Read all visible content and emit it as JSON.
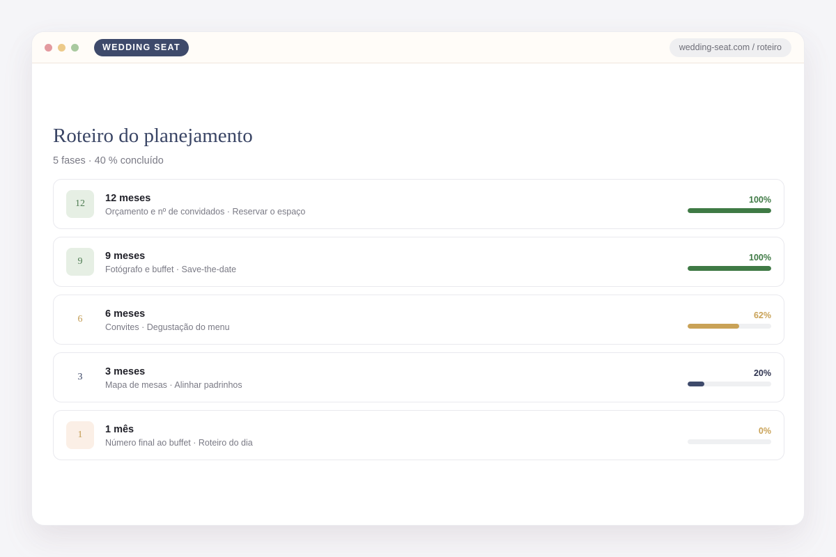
{
  "window": {
    "brand": "WEDDING SEAT",
    "url": "wedding-seat.com / roteiro"
  },
  "page": {
    "title": "Roteiro do planejamento",
    "subtitle": "5 fases · 40 % concluído"
  },
  "phases": [
    {
      "badge": "12",
      "title": "12 meses",
      "tasks": "Orçamento e nº de convidados · Reservar o espaço",
      "percent_label": "100%",
      "progress": 100,
      "badge_bg": "#e6efe4",
      "badge_color": "#4e7c52",
      "accent": "#3f7a45"
    },
    {
      "badge": "9",
      "title": "9 meses",
      "tasks": "Fotógrafo e buffet · Save-the-date",
      "percent_label": "100%",
      "progress": 100,
      "badge_bg": "#e6efe4",
      "badge_color": "#4e7c52",
      "accent": "#3f7a45"
    },
    {
      "badge": "6",
      "title": "6 meses",
      "tasks": "Convites · Degustação do menu",
      "percent_label": "62%",
      "progress": 62,
      "badge_bg": "#ffffff",
      "badge_color": "#c29b52",
      "accent": "#c9a257"
    },
    {
      "badge": "3",
      "title": "3 meses",
      "tasks": "Mapa de mesas · Alinhar padrinhos",
      "percent_label": "20%",
      "progress": 20,
      "badge_bg": "#ffffff",
      "badge_color": "#3a4565",
      "accent": "#3e4a6b",
      "pct_color": "#2f3450"
    },
    {
      "badge": "1",
      "title": "1 mês",
      "tasks": "Número final ao buffet · Roteiro do dia",
      "percent_label": "0%",
      "progress": 0,
      "badge_bg": "#fbefe6",
      "badge_color": "#c29b52",
      "accent": "#c9a257"
    }
  ]
}
